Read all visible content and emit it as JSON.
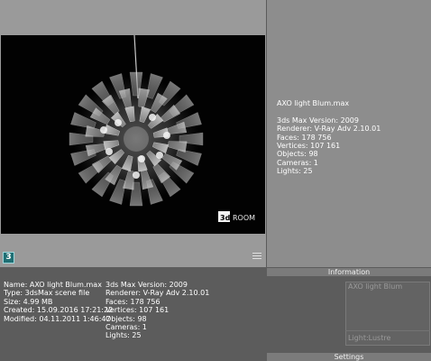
{
  "preview": {
    "watermark_3d": "3d",
    "watermark_room": "ROOM",
    "badge": "3"
  },
  "file_info": {
    "filename": "AXO light Blum.max",
    "max_version": "3ds Max Version: 2009",
    "renderer": "Renderer: V-Ray Adv 2.10.01",
    "faces": "Faces: 178 756",
    "vertices": "Vertices: 107 161",
    "objects": "Objects: 98",
    "cameras": "Cameras: 1",
    "lights": "Lights: 25"
  },
  "details": {
    "name": "Name: AXO light Blum.max",
    "type": "Type: 3dsMax scene file",
    "size": "Size: 4.99 MB",
    "created": "Created: 15.09.2016 17:21:22",
    "modified": "Modified: 04.11.2011 1:46:47"
  },
  "information_panel": {
    "header": "Information",
    "name_value": "AXO light Blum",
    "light_value": "Light:Lustre",
    "settings_header": "Settings"
  },
  "colors": {
    "badge_bg": "#1f6f74",
    "panel_bg": "#5c5c5c",
    "thumb_bg": "#020202"
  }
}
